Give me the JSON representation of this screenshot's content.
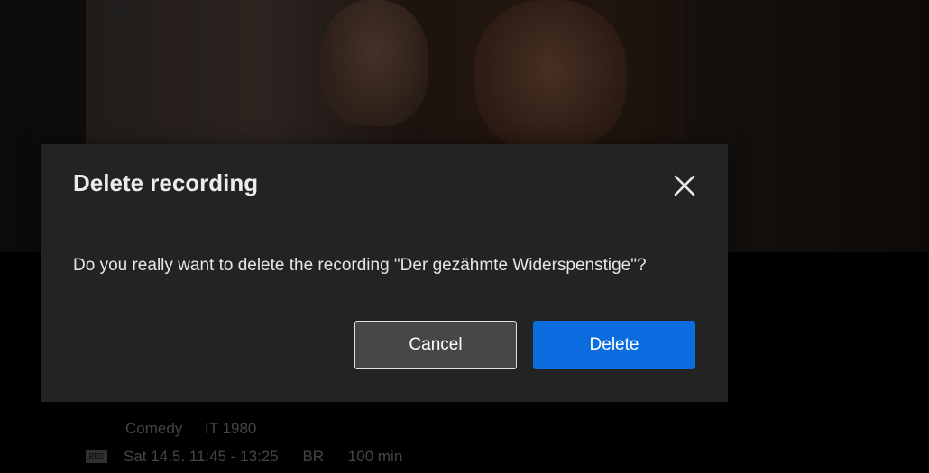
{
  "background": {
    "channel_logo": "BR"
  },
  "program": {
    "genre": "Comedy",
    "country_year": "IT 1980",
    "rec_badge": "REC",
    "datetime": "Sat 14.5. 11:45 - 13:25",
    "channel": "BR",
    "duration": "100 min"
  },
  "dialog": {
    "title": "Delete recording",
    "message": "Do you really want to delete the recording \"Der gezähmte Widerspenstige\"?",
    "cancel_label": "Cancel",
    "delete_label": "Delete",
    "close_icon": "close-icon"
  },
  "colors": {
    "dialog_bg": "#232323",
    "delete_button": "#0b6ce0",
    "cancel_button": "#474747"
  }
}
